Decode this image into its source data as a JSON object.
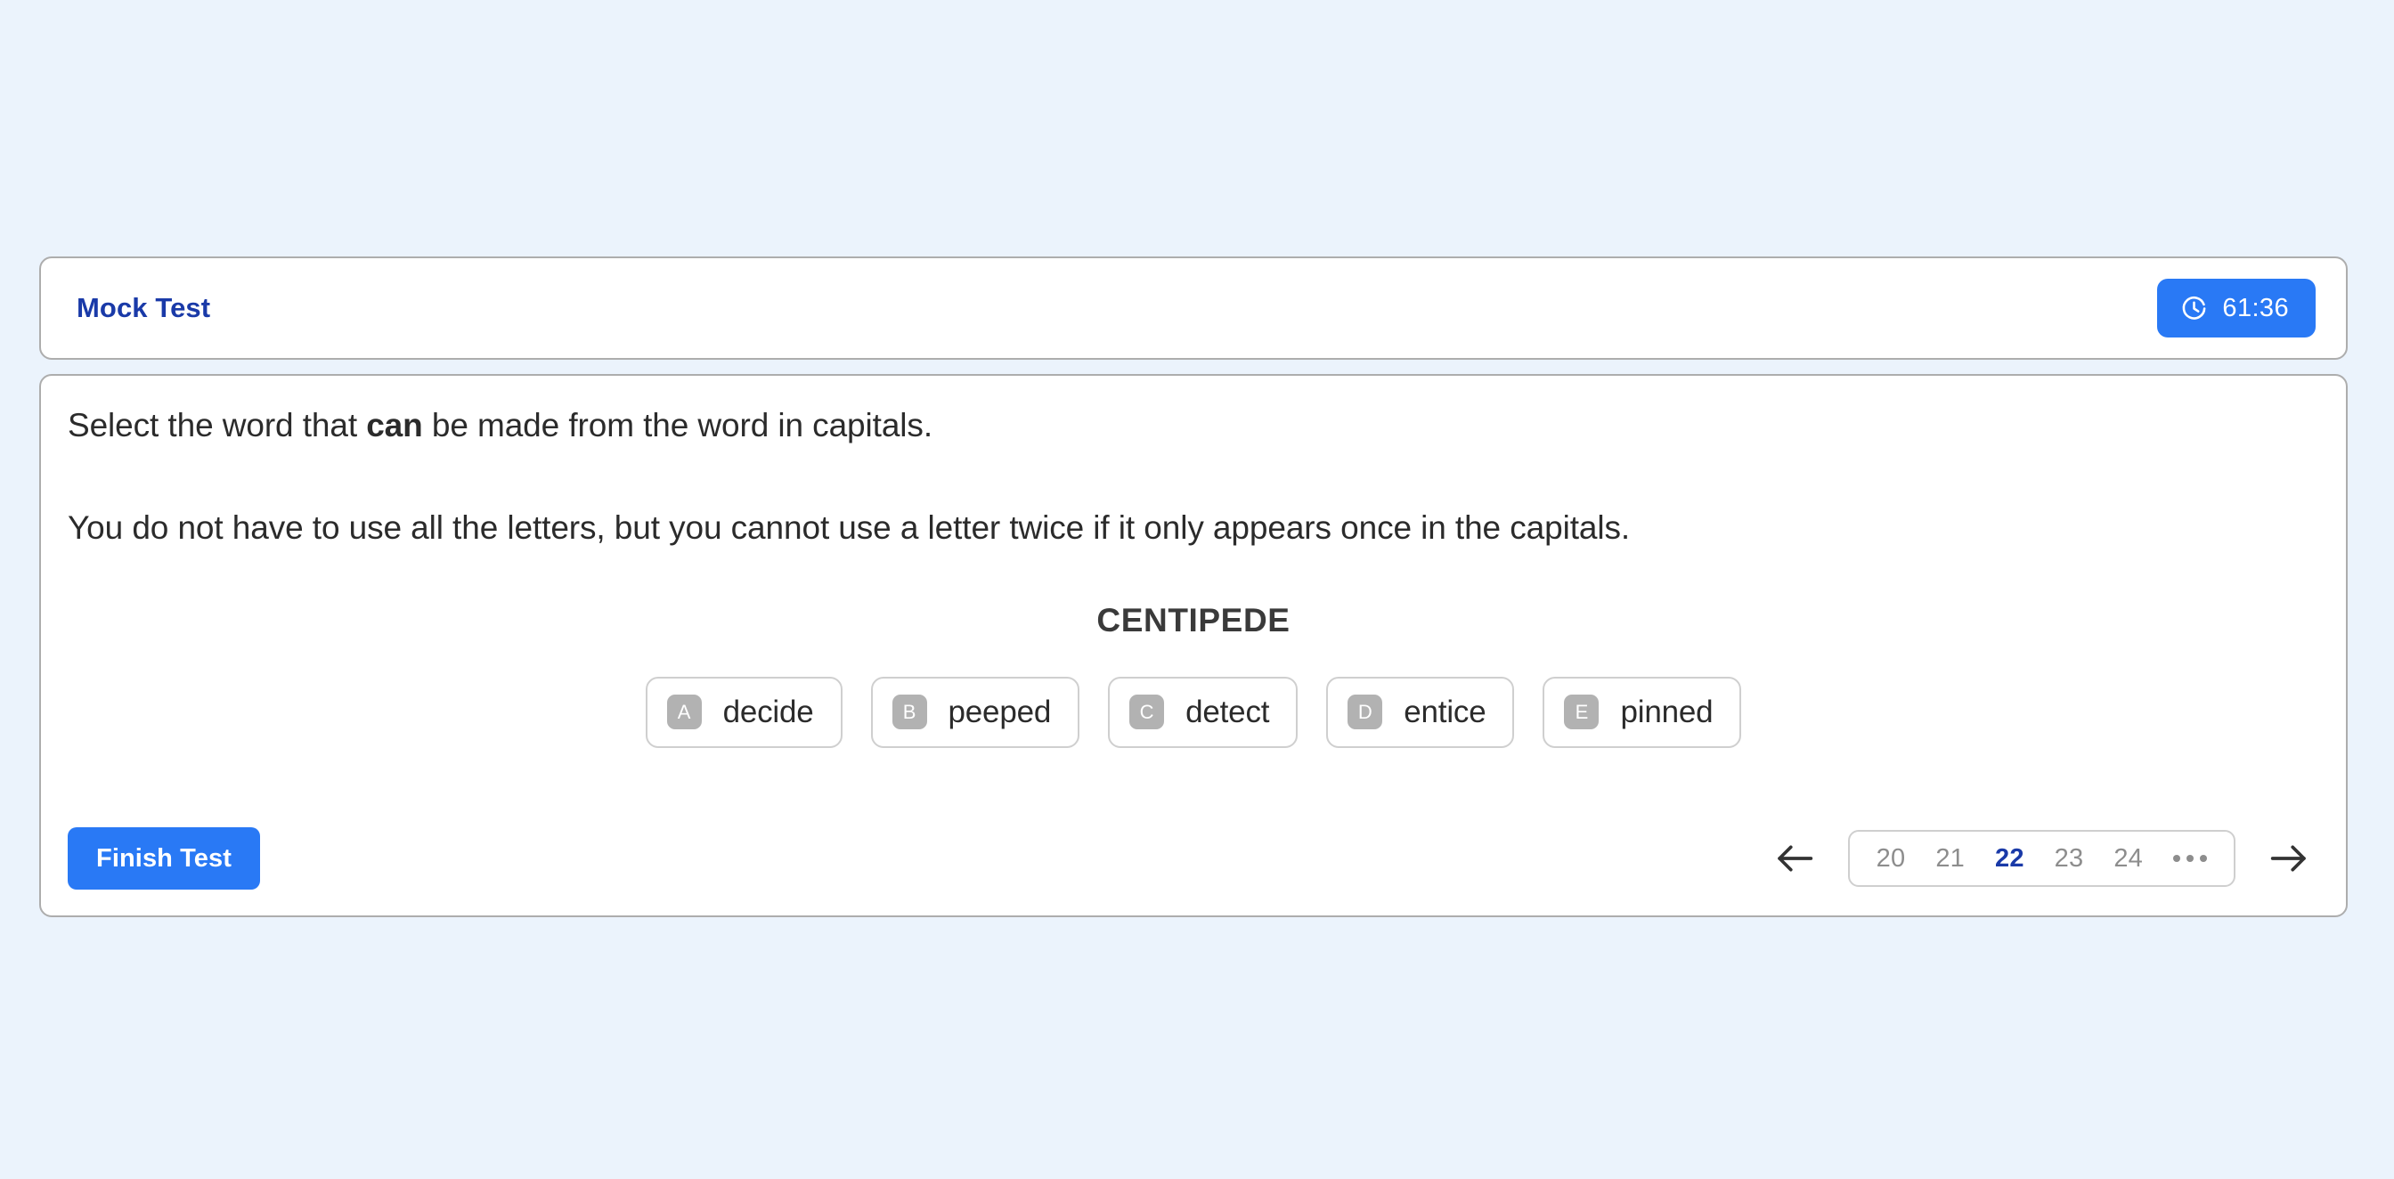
{
  "header": {
    "title": "Mock Test",
    "timer": {
      "icon": "timer-icon",
      "value": "61:36"
    }
  },
  "question": {
    "instruction_prefix": "Select the word that ",
    "instruction_emphasis": "can",
    "instruction_suffix": " be made from the word in capitals.",
    "note": "You do not have to use all the letters, but you cannot use a letter twice if it only appears once in the capitals.",
    "capitals_word": "CENTIPEDE",
    "options": [
      {
        "letter": "A",
        "label": "decide"
      },
      {
        "letter": "B",
        "label": "peeped"
      },
      {
        "letter": "C",
        "label": "detect"
      },
      {
        "letter": "D",
        "label": "entice"
      },
      {
        "letter": "E",
        "label": "pinned"
      }
    ]
  },
  "footer": {
    "finish_label": "Finish Test",
    "prev_icon": "arrow-left-icon",
    "next_icon": "arrow-right-icon",
    "pages": [
      "20",
      "21",
      "22",
      "23",
      "24"
    ],
    "active_page": "22",
    "overflow_label": "•••"
  },
  "colors": {
    "page_background": "#ebf3fc",
    "accent_blue": "#2979f5",
    "title_blue": "#1a3aa8",
    "card_border": "#adadad",
    "option_border": "#cfcfcf",
    "badge_gray": "#b2b2b2",
    "text_dark": "#2b2b2b",
    "muted_gray": "#8d8d8d"
  }
}
